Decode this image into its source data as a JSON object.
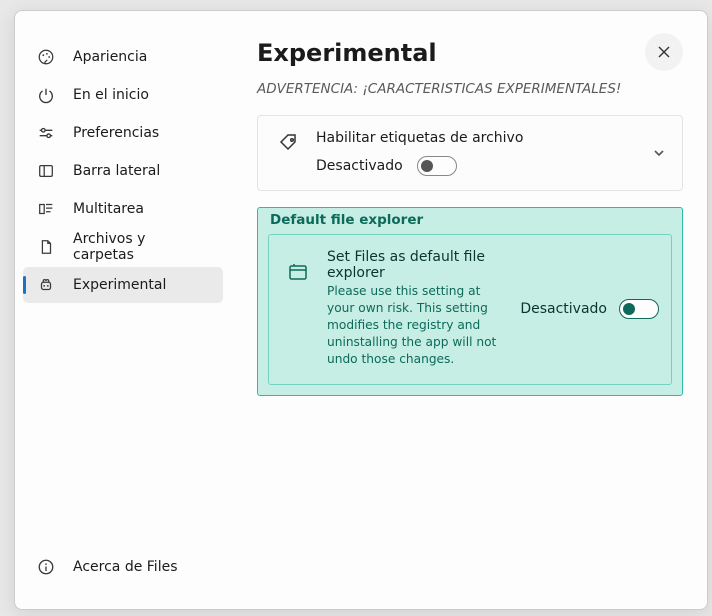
{
  "sidebar": {
    "items": [
      {
        "label": "Apariencia"
      },
      {
        "label": "En el inicio"
      },
      {
        "label": "Preferencias"
      },
      {
        "label": "Barra lateral"
      },
      {
        "label": "Multitarea"
      },
      {
        "label": "Archivos y carpetas"
      },
      {
        "label": "Experimental"
      }
    ],
    "about": "Acerca de Files"
  },
  "content": {
    "title": "Experimental",
    "warning": "ADVERTENCIA: ¡CARACTERISTICAS EXPERIMENTALES!",
    "tags_card": {
      "title": "Habilitar etiquetas de archivo",
      "state": "Desactivado"
    },
    "default_section": {
      "heading": "Default file explorer",
      "card": {
        "title": "Set Files as default file explorer",
        "desc": "Please use this setting at your own risk. This setting modifies the registry and uninstalling the app will not undo those changes.",
        "state": "Desactivado"
      }
    }
  }
}
